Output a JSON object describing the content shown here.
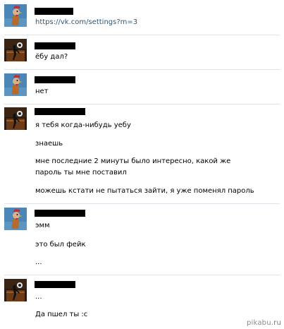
{
  "messages": [
    {
      "sender": "friend",
      "texts": [
        "https://vk.com/settings?m=3"
      ]
    },
    {
      "sender": "me",
      "texts": [
        "ёбу дал?"
      ]
    },
    {
      "sender": "friend",
      "texts": [
        "нет"
      ]
    },
    {
      "sender": "me",
      "texts": [
        "я тебя когда-нибудь уебу",
        "знаешь",
        "мне последние 2 минуты было интересно, какой же пароль ты мне поставил",
        "можешь кстати не пытаться зайти, я уже поменял пароль"
      ]
    },
    {
      "sender": "friend",
      "texts": [
        "эмм",
        "это был фейк",
        "..."
      ]
    },
    {
      "sender": "me",
      "texts": [
        "...",
        "Да пшел ты :c"
      ]
    }
  ],
  "avatars": {
    "friend": "rooster-avatar",
    "me": "dark-figure-avatar"
  },
  "colors": {
    "link": "#2b587a",
    "text": "#000000",
    "friend_avatar_bg": "#4a86b8",
    "me_avatar_bg": "#2a1a10",
    "watermark_name": "#8a8a8a",
    "watermark_tld": "#5d7ea1"
  },
  "watermark": {
    "name": "pikabu",
    "tld": ".ru"
  }
}
